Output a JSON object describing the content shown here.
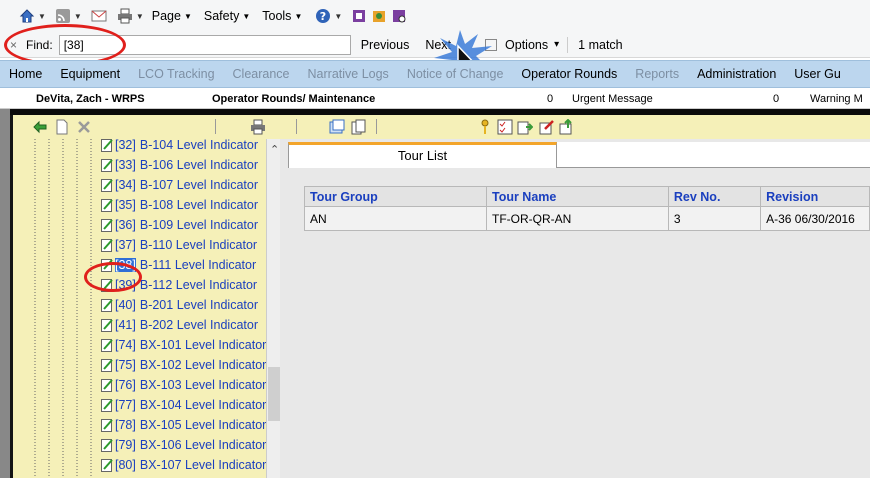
{
  "toolbar": {
    "menus": [
      {
        "label": "Page"
      },
      {
        "label": "Safety"
      },
      {
        "label": "Tools"
      }
    ]
  },
  "findbar": {
    "close_glyph": "×",
    "label": "Find:",
    "value": "[38]",
    "previous": "Previous",
    "next": "Next",
    "options": "Options",
    "options_arrow": "▾",
    "match_count": "1 match"
  },
  "nav": {
    "items": [
      {
        "label": "Home",
        "enabled": true
      },
      {
        "label": "Equipment",
        "enabled": true
      },
      {
        "label": "LCO Tracking",
        "enabled": false
      },
      {
        "label": "Clearance",
        "enabled": false
      },
      {
        "label": "Narrative Logs",
        "enabled": false
      },
      {
        "label": "Notice of Change",
        "enabled": false
      },
      {
        "label": "Operator Rounds",
        "enabled": true
      },
      {
        "label": "Reports",
        "enabled": false
      },
      {
        "label": "Administration",
        "enabled": true
      },
      {
        "label": "User Gu",
        "enabled": true
      }
    ]
  },
  "status": {
    "user": "DeVita, Zach - WRPS",
    "module": "Operator Rounds/ Maintenance",
    "urgent_count": "0",
    "urgent_label": "Urgent Message",
    "warning_count": "0",
    "warning_label": "Warning M"
  },
  "tree": {
    "items": [
      {
        "code": "[32]",
        "name": "B-104 Level Indicator",
        "selected": false
      },
      {
        "code": "[33]",
        "name": "B-106 Level Indicator",
        "selected": false
      },
      {
        "code": "[34]",
        "name": "B-107 Level Indicator",
        "selected": false
      },
      {
        "code": "[35]",
        "name": "B-108 Level Indicator",
        "selected": false
      },
      {
        "code": "[36]",
        "name": "B-109 Level Indicator",
        "selected": false
      },
      {
        "code": "[37]",
        "name": "B-110 Level Indicator",
        "selected": false
      },
      {
        "code": "[38]",
        "name": "B-111 Level Indicator",
        "selected": true
      },
      {
        "code": "[39]",
        "name": "B-112 Level Indicator",
        "selected": false
      },
      {
        "code": "[40]",
        "name": "B-201 Level Indicator",
        "selected": false
      },
      {
        "code": "[41]",
        "name": "B-202 Level Indicator",
        "selected": false
      },
      {
        "code": "[74]",
        "name": "BX-101 Level Indicator",
        "selected": false
      },
      {
        "code": "[75]",
        "name": "BX-102 Level Indicator",
        "selected": false
      },
      {
        "code": "[76]",
        "name": "BX-103 Level Indicator",
        "selected": false
      },
      {
        "code": "[77]",
        "name": "BX-104 Level Indicator",
        "selected": false
      },
      {
        "code": "[78]",
        "name": "BX-105 Level Indicator",
        "selected": false
      },
      {
        "code": "[79]",
        "name": "BX-106 Level Indicator",
        "selected": false
      },
      {
        "code": "[80]",
        "name": "BX-107 Level Indicator",
        "selected": false
      }
    ]
  },
  "tour_list": {
    "tab_label": "Tour List",
    "columns": [
      "Tour Group",
      "Tour Name",
      "Rev No.",
      "Revision"
    ],
    "rows": [
      [
        "AN",
        "TF-OR-QR-AN",
        "3",
        "A-36 06/30/2016"
      ]
    ]
  },
  "colors": {
    "nav_bg": "#bcd6ee",
    "panel_bg": "#f5f0b8",
    "link_blue": "#1a3fbf",
    "highlight_red": "#e0201c",
    "tab_accent": "#f3a52b"
  }
}
